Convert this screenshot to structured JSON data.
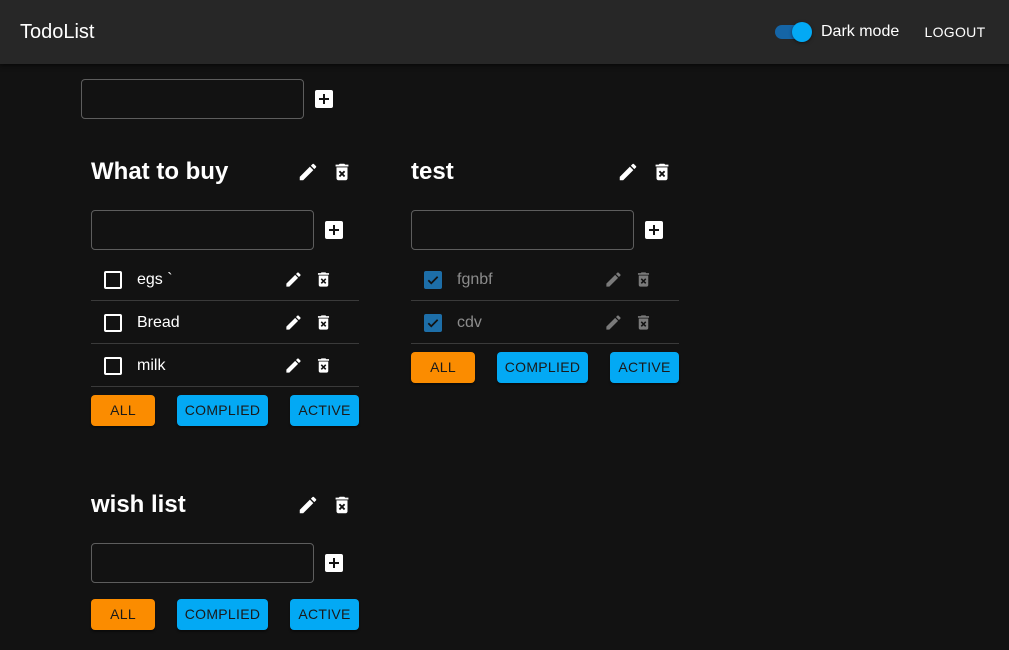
{
  "app": {
    "title": "TodoList",
    "dark_mode_label": "Dark mode",
    "dark_mode_on": true,
    "logout_label": "LOGOUT",
    "new_list_value": ""
  },
  "colors": {
    "appbar": "#272727",
    "background": "#121212",
    "accent": "#03a9f4",
    "all_button": "#fb8c00",
    "checked": "#1d6ea8"
  },
  "icons": {
    "add": "add-box-icon",
    "edit": "pencil-icon",
    "delete": "delete-forever-icon",
    "check": "check-icon"
  },
  "lists": [
    {
      "title": "What to buy",
      "new_task_value": "",
      "tasks": [
        {
          "text": "egs `",
          "done": false
        },
        {
          "text": "Bread",
          "done": false
        },
        {
          "text": "milk",
          "done": false
        }
      ],
      "filters": {
        "all": "ALL",
        "complied": "COMPLIED",
        "active": "ACTIVE"
      }
    },
    {
      "title": "test",
      "new_task_value": "",
      "tasks": [
        {
          "text": "fgnbf",
          "done": true
        },
        {
          "text": "cdv",
          "done": true
        }
      ],
      "filters": {
        "all": "ALL",
        "complied": "COMPLIED",
        "active": "ACTIVE"
      }
    },
    {
      "title": "wish list",
      "new_task_value": "",
      "tasks": [],
      "filters": {
        "all": "ALL",
        "complied": "COMPLIED",
        "active": "ACTIVE"
      }
    }
  ]
}
